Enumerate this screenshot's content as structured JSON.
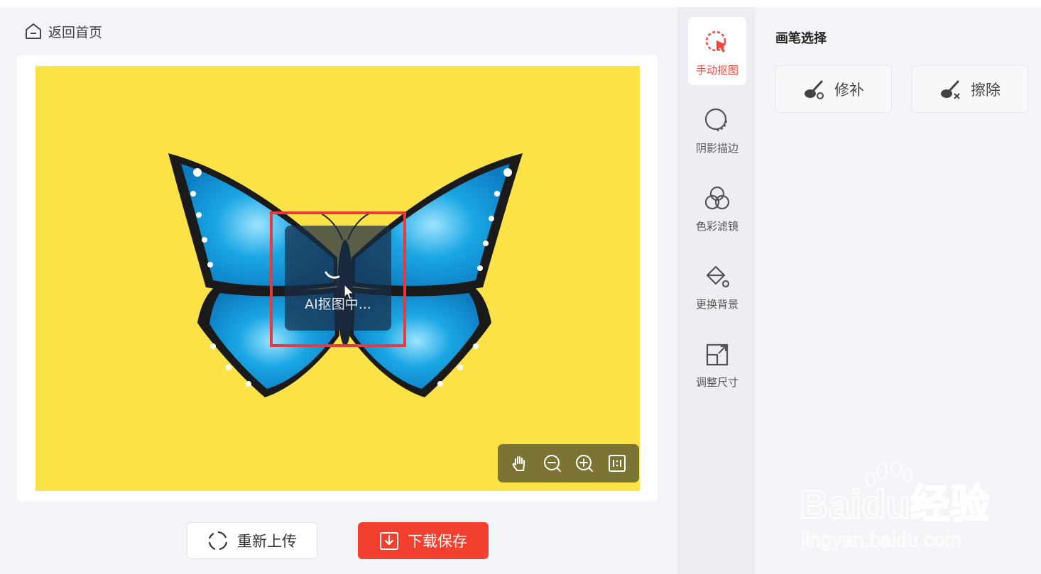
{
  "nav": {
    "back_label": "返回首页",
    "back_icon": "home-icon"
  },
  "canvas": {
    "background_color": "#fbe246",
    "loading_text": "AI抠图中...",
    "selection_color": "#e83a3a"
  },
  "zoom_controls": [
    "hand-icon",
    "zoom-out-icon",
    "zoom-in-icon",
    "actual-size-icon"
  ],
  "actions": {
    "reupload_label": "重新上传",
    "download_label": "下载保存"
  },
  "tools": [
    {
      "label": "手动抠图",
      "icon": "manual-cutout-icon",
      "active": true
    },
    {
      "label": "阴影描边",
      "icon": "shadow-outline-icon",
      "active": false
    },
    {
      "label": "色彩滤镜",
      "icon": "color-filter-icon",
      "active": false
    },
    {
      "label": "更换背景",
      "icon": "paint-bucket-icon",
      "active": false
    },
    {
      "label": "调整尺寸",
      "icon": "resize-icon",
      "active": false
    }
  ],
  "panel": {
    "title": "画笔选择",
    "brushes": [
      {
        "label": "修补",
        "icon": "repair-brush-icon"
      },
      {
        "label": "擦除",
        "icon": "erase-brush-icon"
      }
    ]
  },
  "watermark": {
    "logo": "Baidu经验",
    "url": "jingyan.baidu.com"
  },
  "colors": {
    "accent": "#f23f2e",
    "active_tool": "#f0483b"
  }
}
